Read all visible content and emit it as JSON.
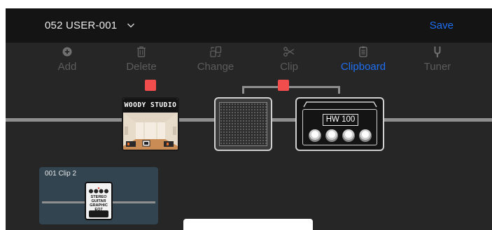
{
  "header": {
    "preset_name": "052 USER-001",
    "save_label": "Save"
  },
  "toolbar": [
    {
      "label": "Add",
      "icon": "add-circle-icon",
      "active": false
    },
    {
      "label": "Delete",
      "icon": "trash-icon",
      "active": false
    },
    {
      "label": "Change",
      "icon": "change-icon",
      "active": false
    },
    {
      "label": "Clip",
      "icon": "scissors-icon",
      "active": false
    },
    {
      "label": "Clipboard",
      "icon": "clipboard-icon",
      "active": true
    },
    {
      "label": "Tuner",
      "icon": "tuning-fork-icon",
      "active": false
    }
  ],
  "chain": {
    "woody_block": {
      "title": "WOODY STUDIO"
    },
    "cab_block": {
      "icon": "speaker-cabinet-icon"
    },
    "amp_block": {
      "label": "HW 100"
    }
  },
  "clipboard": {
    "clip_title": "001   Clip 2",
    "pedal_text": "STEREO GUITAR GRAPHIC EQ7"
  },
  "colors": {
    "accent": "#1e6ff2",
    "handle": "#f14d4d",
    "background": "#262626",
    "topbar": "#141414",
    "clip_card": "#324450"
  }
}
